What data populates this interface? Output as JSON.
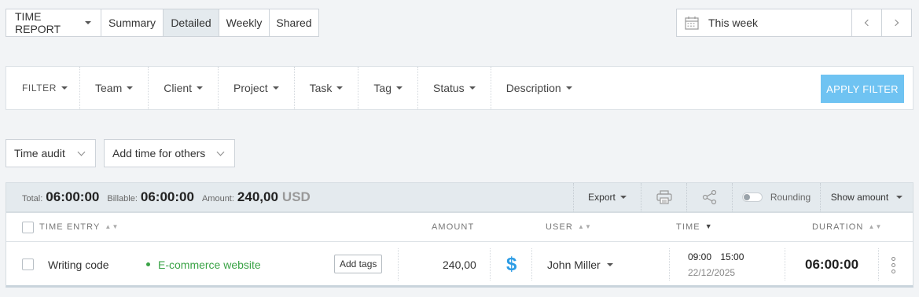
{
  "header": {
    "report_label": "TIME REPORT",
    "tabs": [
      {
        "label": "Summary",
        "active": false
      },
      {
        "label": "Detailed",
        "active": true
      },
      {
        "label": "Weekly",
        "active": false
      },
      {
        "label": "Shared",
        "active": false
      }
    ],
    "date_range": "This week"
  },
  "filters": {
    "filter_label": "FILTER",
    "items": [
      "Team",
      "Client",
      "Project",
      "Task",
      "Tag",
      "Status",
      "Description"
    ],
    "apply_label": "APPLY FILTER"
  },
  "dropdowns": {
    "time_audit": "Time audit",
    "add_time": "Add time for others"
  },
  "summary": {
    "total_label": "Total:",
    "total_value": "06:00:00",
    "billable_label": "Billable:",
    "billable_value": "06:00:00",
    "amount_label": "Amount:",
    "amount_value": "240,00",
    "currency": "USD",
    "export_label": "Export",
    "rounding_label": "Rounding",
    "rounding_on": false,
    "show_amount_label": "Show amount"
  },
  "table": {
    "columns": {
      "entry": "TIME ENTRY",
      "amount": "AMOUNT",
      "user": "USER",
      "time": "TIME",
      "duration": "DURATION"
    },
    "rows": [
      {
        "description": "Writing code",
        "project": "E-commerce website",
        "project_color": "#3aa346",
        "tags_label": "Add tags",
        "amount": "240,00",
        "billable_symbol": "$",
        "user": "John Miller",
        "start": "09:00",
        "end": "15:00",
        "date": "22/12/2025",
        "duration": "06:00:00"
      }
    ]
  },
  "colors": {
    "accent": "#6fc3f2",
    "billable": "#2c9ce5",
    "header_bg": "#e4eaee"
  }
}
